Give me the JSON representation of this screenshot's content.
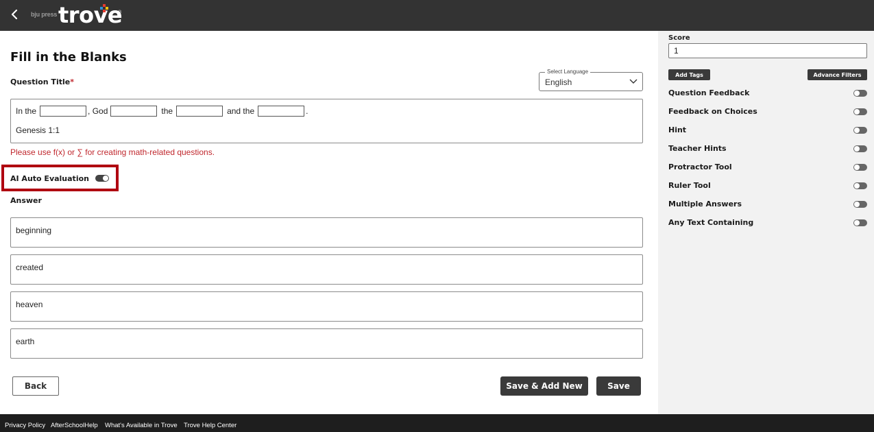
{
  "brand": {
    "small": "bju press",
    "main": "trove",
    "reg": "®"
  },
  "form": {
    "title": "Fill in the Blanks",
    "question_title_label": "Question Title",
    "required_mark": "*",
    "language": {
      "legend": "Select Language",
      "value": "English"
    },
    "question": {
      "parts": [
        "In the",
        ", God",
        "the",
        "and the",
        "."
      ],
      "reference": "Genesis 1:1"
    },
    "math_hint": "Please use f(x) or ∑ for creating math-related questions.",
    "ai_auto_evaluation": {
      "label": "AI Auto Evaluation",
      "enabled": true
    },
    "answer_label": "Answer",
    "answers": [
      "beginning",
      "created",
      "heaven",
      "earth"
    ],
    "buttons": {
      "back": "Back",
      "save_add_new": "Save & Add New",
      "save": "Save"
    }
  },
  "sidebar": {
    "score_label": "Score",
    "score_value": "1",
    "add_tags": "Add Tags",
    "advance_filters": "Advance Filters",
    "options": [
      {
        "label": "Question Feedback",
        "enabled": false
      },
      {
        "label": "Feedback on Choices",
        "enabled": false
      },
      {
        "label": "Hint",
        "enabled": false
      },
      {
        "label": "Teacher Hints",
        "enabled": false
      },
      {
        "label": "Protractor Tool",
        "enabled": false
      },
      {
        "label": "Ruler Tool",
        "enabled": false
      },
      {
        "label": "Multiple Answers",
        "enabled": false
      },
      {
        "label": "Any Text Containing",
        "enabled": false
      }
    ]
  },
  "footer": {
    "links": [
      "Privacy Policy",
      "AfterSchoolHelp",
      "What's Available in Trove",
      "Trove Help Center"
    ]
  },
  "colors": {
    "topbar": "#333333",
    "required": "#c0272d",
    "highlight_border": "#b00010",
    "dark_button": "#3a3a3a",
    "sidebar_bg": "#f2f2f2",
    "footer_bg": "#1e1e1e"
  }
}
